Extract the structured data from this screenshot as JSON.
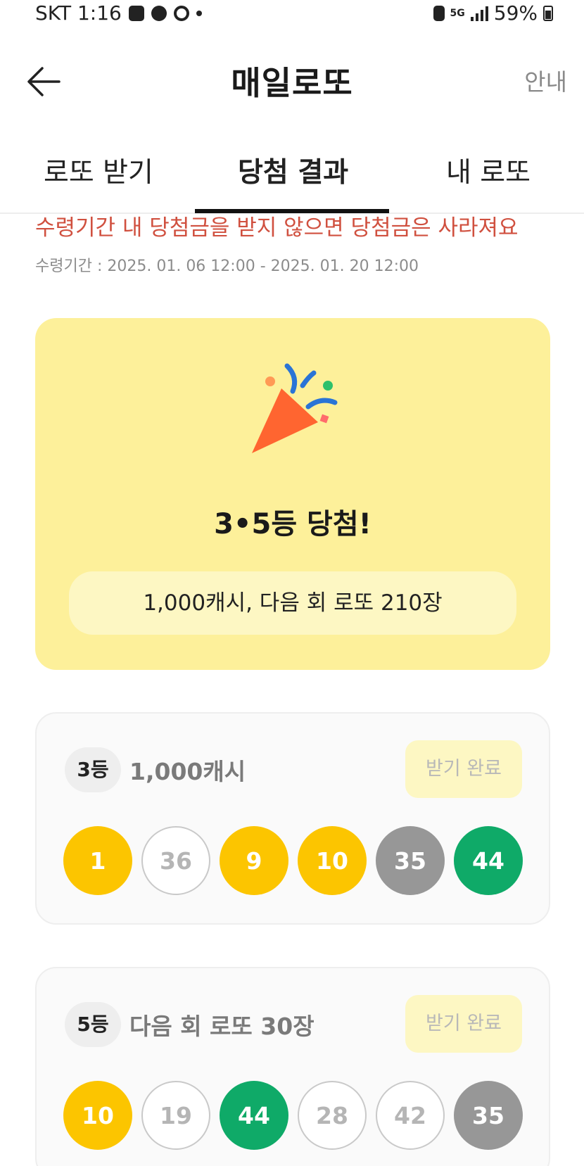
{
  "status_bar": {
    "time_text": "SKT 1:16",
    "battery": "59%",
    "network": "5G"
  },
  "header": {
    "title": "매일로또",
    "info_label": "안내"
  },
  "tabs": [
    {
      "label": "로또 받기",
      "active": false
    },
    {
      "label": "당첨 결과",
      "active": true
    },
    {
      "label": "내 로또",
      "active": false
    }
  ],
  "notice": {
    "warning": "수령기간 내 당첨금을 받지 않으면 당첨금은 사라져요",
    "period": "수령기간 : 2025. 01. 06 12:00 - 2025. 01. 20 12:00"
  },
  "win_card": {
    "icon": "party-popper-icon",
    "title": "3•5등 당첨!",
    "summary": "1,000캐시, 다음 회 로또 210장"
  },
  "prizes": [
    {
      "rank": "3등",
      "label": "1,000캐시",
      "claim_label": "받기 완료",
      "balls": [
        {
          "number": "1",
          "style": "yellow"
        },
        {
          "number": "36",
          "style": "white"
        },
        {
          "number": "9",
          "style": "yellow"
        },
        {
          "number": "10",
          "style": "yellow"
        },
        {
          "number": "35",
          "style": "gray"
        },
        {
          "number": "44",
          "style": "green"
        }
      ]
    },
    {
      "rank": "5등",
      "label": "다음 회 로또 30장",
      "claim_label": "받기 완료",
      "balls": [
        {
          "number": "10",
          "style": "yellow"
        },
        {
          "number": "19",
          "style": "white"
        },
        {
          "number": "44",
          "style": "green"
        },
        {
          "number": "28",
          "style": "white"
        },
        {
          "number": "42",
          "style": "white"
        },
        {
          "number": "35",
          "style": "gray"
        }
      ]
    }
  ],
  "colors": {
    "accent_yellow": "#fcc500",
    "ball_green": "#0faa68",
    "ball_gray": "#979797",
    "warning_red": "#d0503f",
    "card_yellow": "#fdf09a"
  }
}
